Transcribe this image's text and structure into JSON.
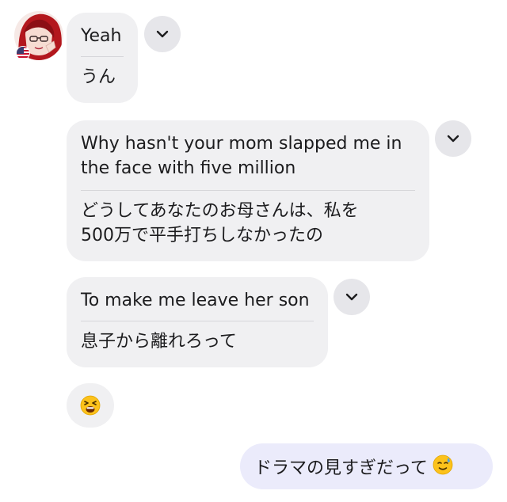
{
  "conversation": {
    "messages": [
      {
        "original": "Yeah",
        "translation": "うん"
      },
      {
        "original_lines": [
          "Why hasn't your mom slapped me in",
          "the face with five million"
        ],
        "translation_lines": [
          "どうしてあなたのお母さんは、私を",
          "500万で平手打ちしなかったの"
        ]
      },
      {
        "original": "To make me leave her son",
        "translation": "息子から離れろって"
      }
    ],
    "emoji_reaction": {
      "icon": "tired-face-emoji"
    },
    "sent": {
      "text": "ドラマの見すぎだって",
      "emoji": "sweat-smile-emoji"
    }
  },
  "sender": {
    "flag": "us-flag-icon"
  },
  "colors": {
    "received_bubble": "#f0f0f2",
    "sent_bubble": "#ebebfb",
    "expand_button": "#e6e6ea",
    "divider": "#d6d6da"
  }
}
